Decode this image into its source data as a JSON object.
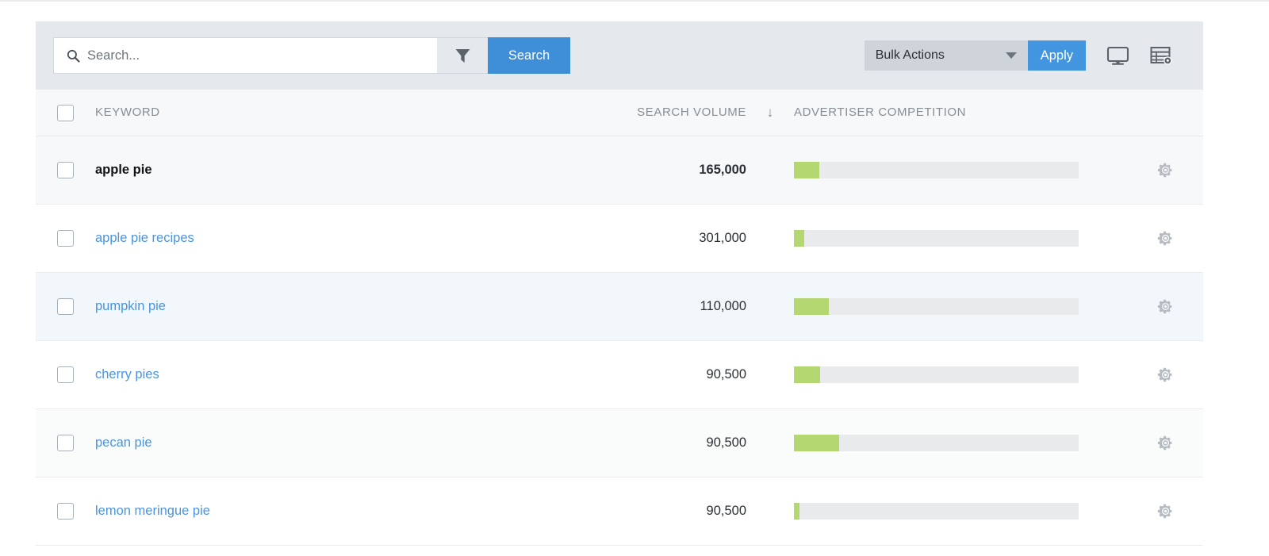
{
  "toolbar": {
    "search_placeholder": "Search...",
    "search_value": "",
    "search_button_label": "Search",
    "filter_icon": "filter-funnel-icon",
    "search_icon": "search-icon",
    "bulk_actions_label": "Bulk Actions",
    "apply_button_label": "Apply",
    "monitor_icon": "monitor-display-icon",
    "grid_settings_icon": "table-settings-icon",
    "accent_blue": "#4296e0",
    "toolbar_bg": "#e5e9ee"
  },
  "table": {
    "columns": {
      "keyword": "KEYWORD",
      "search_volume": "SEARCH VOLUME",
      "advertiser_competition": "ADVERTISER COMPETITION"
    },
    "sort_indicator": "↓",
    "sorted_column": "SEARCH VOLUME",
    "sort_direction": "descending",
    "bar_fill_color": "#b5d771",
    "bar_track_color": "#e8eaec",
    "link_color": "#4a94e0",
    "rows": [
      {
        "keyword": "apple pie",
        "volume": "165,000",
        "competition_pct": 9,
        "is_seed": true,
        "row_bg": "bg-gray",
        "gear_icon": "gear-icon"
      },
      {
        "keyword": "apple pie recipes",
        "volume": "301,000",
        "competition_pct": 3.6,
        "is_seed": false,
        "row_bg": "bg-white",
        "gear_icon": "gear-icon"
      },
      {
        "keyword": "pumpkin pie",
        "volume": "110,000",
        "competition_pct": 12.3,
        "is_seed": false,
        "row_bg": "bg-blue",
        "gear_icon": "gear-icon"
      },
      {
        "keyword": "cherry pies",
        "volume": "90,500",
        "competition_pct": 9.2,
        "is_seed": false,
        "row_bg": "bg-white",
        "gear_icon": "gear-icon"
      },
      {
        "keyword": "pecan pie",
        "volume": "90,500",
        "competition_pct": 15.9,
        "is_seed": false,
        "row_bg": "bg-faint",
        "gear_icon": "gear-icon"
      },
      {
        "keyword": "lemon meringue pie",
        "volume": "90,500",
        "competition_pct": 2,
        "is_seed": false,
        "row_bg": "bg-white",
        "gear_icon": "gear-icon"
      }
    ]
  },
  "chart_data": {
    "type": "bar",
    "title": "Advertiser Competition by Keyword",
    "categories": [
      "apple pie",
      "apple pie recipes",
      "pumpkin pie",
      "cherry pies",
      "pecan pie",
      "lemon meringue pie"
    ],
    "series": [
      {
        "name": "Advertiser Competition (%)",
        "values": [
          9,
          3.6,
          12.3,
          9.2,
          15.9,
          2
        ]
      },
      {
        "name": "Search Volume",
        "values": [
          165000,
          301000,
          110000,
          90500,
          90500,
          90500
        ]
      }
    ],
    "xlabel": "",
    "ylabel": "Advertiser Competition",
    "ylim": [
      0,
      100
    ],
    "grid": false,
    "legend": "none"
  }
}
